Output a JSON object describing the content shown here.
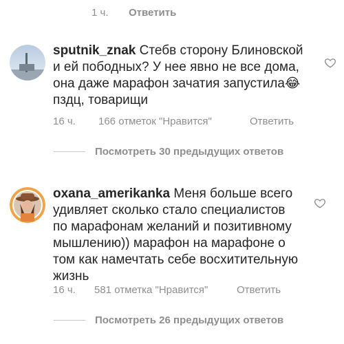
{
  "top_partial": {
    "time": "1 ч.",
    "reply_label": "Ответить"
  },
  "comments": [
    {
      "username": "sputnik_znak",
      "text": "Стебв сторону Блиновской и ей пободных? У нее явно не все дома, она даже марафон зачатия запустила😂 пздц, товарищи",
      "time": "16 ч.",
      "likes": "166 отметок \"Нравится\"",
      "reply_label": "Ответить",
      "heart_icon": "heart-outline-icon"
    },
    {
      "username": "oxana_amerikanka",
      "text": "Меня больше всего удивляет сколько стало специалистов по марафонам желаний и позитивному мышлению)) марафон на марафоне о том как намечтать себе восхитительную жизнь",
      "time": "16 ч.",
      "likes": "581 отметка \"Нравится\"",
      "reply_label": "Ответить",
      "heart_icon": "heart-outline-icon"
    }
  ],
  "view_replies": [
    {
      "label": "Посмотреть 30 предыдущих ответов"
    },
    {
      "label": "Посмотреть 26 предыдущих ответов"
    }
  ],
  "colors": {
    "text": "#262626",
    "meta": "#8e8e8e",
    "divider": "#c7c7c7"
  }
}
